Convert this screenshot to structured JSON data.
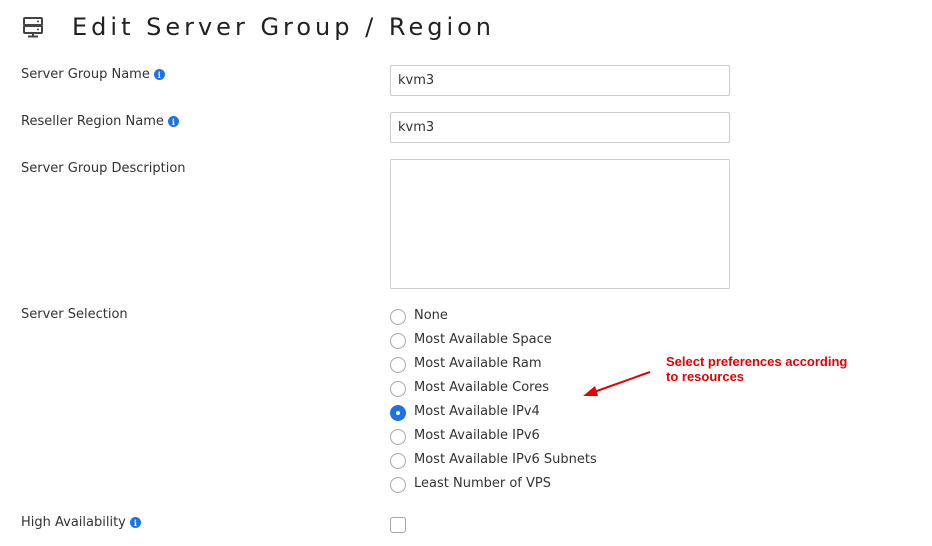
{
  "header": {
    "title": "Edit Server Group / Region",
    "icon": "server-icon"
  },
  "form": {
    "group_name": {
      "label": "Server Group Name",
      "value": "kvm3"
    },
    "reseller_region": {
      "label": "Reseller Region Name",
      "value": "kvm3"
    },
    "description": {
      "label": "Server Group Description",
      "value": ""
    },
    "server_selection": {
      "label": "Server Selection",
      "selected": "Most Available IPv4",
      "options": [
        "None",
        "Most Available Space",
        "Most Available Ram",
        "Most Available Cores",
        "Most Available IPv4",
        "Most Available IPv6",
        "Most Available IPv6 Subnets",
        "Least Number of VPS"
      ]
    },
    "high_availability": {
      "label": "High Availability",
      "checked": false
    }
  },
  "annotation": {
    "line1": "Select preferences according",
    "line2": "to resources",
    "color": "#e60000"
  },
  "colors": {
    "accent": "#1a73e8",
    "info": "#1a73e8"
  }
}
